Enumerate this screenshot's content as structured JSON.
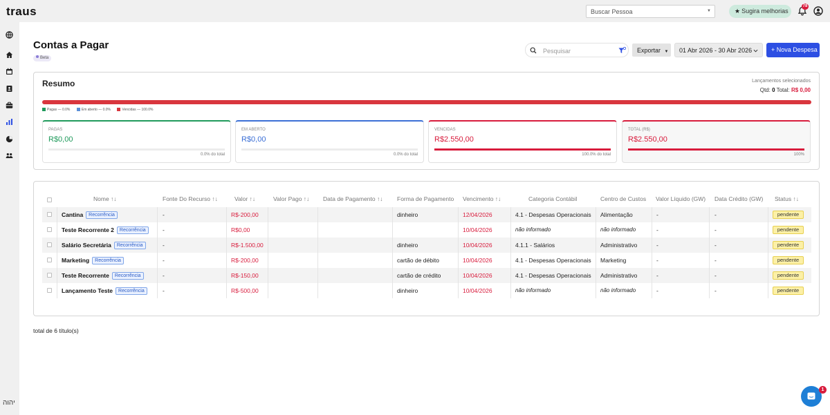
{
  "app": {
    "logo": "traus"
  },
  "topbar": {
    "person_search_placeholder": "Buscar Pessoa",
    "suggest_label": "Sugira melhorias",
    "notification_count": "78"
  },
  "sidebar": {
    "icons": [
      "globe-icon",
      "home-icon",
      "calendar-icon",
      "contacts-icon",
      "briefcase-icon",
      "bar-chart-icon",
      "pie-chart-icon",
      "team-icon"
    ],
    "footer_text": "יהוה"
  },
  "header": {
    "title": "Contas a Pagar",
    "badge": "Beta",
    "search_placeholder": "Pesquisar",
    "export_label": "Exportar",
    "date_range": "01 Abr 2026 - 30 Abr 2026",
    "new_button": "+ Nova Despesa"
  },
  "summary": {
    "title": "Resumo",
    "selected_label": "Lançamentos selecionados",
    "qtd_label": "Qtd:",
    "qtd_value": "0",
    "total_label": "Total:",
    "total_value": "R$ 0,00",
    "legend": [
      {
        "label": "Pagas — 0.0%",
        "color": "#1f9a5b"
      },
      {
        "label": "Em aberto — 0.0%",
        "color": "#5b8fd8"
      },
      {
        "label": "Vencidas — 100.0%",
        "color": "#d9363e"
      }
    ],
    "bar_vencidas_fraction": 1.0,
    "cards": [
      {
        "label": "PAGAS",
        "value": "R$0,00",
        "pct_text": "0.0% do total",
        "fill_fraction": 0.0,
        "color": "#1f9a5b"
      },
      {
        "label": "EM ABERTO",
        "value": "R$0,00",
        "pct_text": "0.0% do total",
        "fill_fraction": 0.0,
        "color": "#3b6fd6"
      },
      {
        "label": "VENCIDAS",
        "value": "R$2.550,00",
        "pct_text": "100.0% do total",
        "fill_fraction": 1.0,
        "color": "#d81b3c"
      },
      {
        "label": "TOTAL (R$)",
        "value": "R$2.550,00",
        "pct_text": "100%",
        "fill_fraction": 1.0,
        "color": "#d81b3c"
      }
    ]
  },
  "table": {
    "headers": [
      "Nome ↑↓",
      "Fonte Do Recurso ↑↓",
      "Valor ↑↓",
      "Valor Pago ↑↓",
      "Data de Pagamento ↑↓",
      "Forma de Pagamento",
      "Vencimento ↑↓",
      "Categoria Contábil",
      "Centro de Custos",
      "Valor Líquido (GW)",
      "Data Crédito (GW)",
      "Status ↑↓"
    ],
    "tag_label": "Recorrência",
    "rows": [
      {
        "name": "Cantina",
        "fonte": "-",
        "valor": "R$-200,00",
        "valor_pago": "",
        "data_pagamento": "",
        "forma": "dinheiro",
        "vencimento": "12/04/2026",
        "categoria": "4.1 - Despesas Operacionais",
        "centro": "Alimentação",
        "liquido": "-",
        "credito": "-",
        "status": "pendente"
      },
      {
        "name": "Teste Recorrente 2",
        "fonte": "-",
        "valor": "R$0,00",
        "valor_pago": "",
        "data_pagamento": "",
        "forma": "",
        "vencimento": "10/04/2026",
        "categoria": "não informado",
        "centro": "não informado",
        "liquido": "-",
        "credito": "-",
        "status": "pendente"
      },
      {
        "name": "Salário Secretária",
        "fonte": "-",
        "valor": "R$-1.500,00",
        "valor_pago": "",
        "data_pagamento": "",
        "forma": "dinheiro",
        "vencimento": "10/04/2026",
        "categoria": "4.1.1 - Salários",
        "centro": "Administrativo",
        "liquido": "-",
        "credito": "-",
        "status": "pendente"
      },
      {
        "name": "Marketing",
        "fonte": "-",
        "valor": "R$-200,00",
        "valor_pago": "",
        "data_pagamento": "",
        "forma": "cartão de débito",
        "vencimento": "10/04/2026",
        "categoria": "4.1 - Despesas Operacionais",
        "centro": "Marketing",
        "liquido": "-",
        "credito": "-",
        "status": "pendente"
      },
      {
        "name": "Teste Recorrente",
        "fonte": "-",
        "valor": "R$-150,00",
        "valor_pago": "",
        "data_pagamento": "",
        "forma": "cartão de crédito",
        "vencimento": "10/04/2026",
        "categoria": "4.1 - Despesas Operacionais",
        "centro": "Administrativo",
        "liquido": "-",
        "credito": "-",
        "status": "pendente"
      },
      {
        "name": "Lançamento Teste",
        "fonte": "-",
        "valor": "R$-500,00",
        "valor_pago": "",
        "data_pagamento": "",
        "forma": "dinheiro",
        "vencimento": "10/04/2026",
        "categoria": "não informado",
        "centro": "não informado",
        "liquido": "-",
        "credito": "-",
        "status": "pendente"
      }
    ]
  },
  "footer": {
    "total_text": "total de 6 título(s)"
  }
}
